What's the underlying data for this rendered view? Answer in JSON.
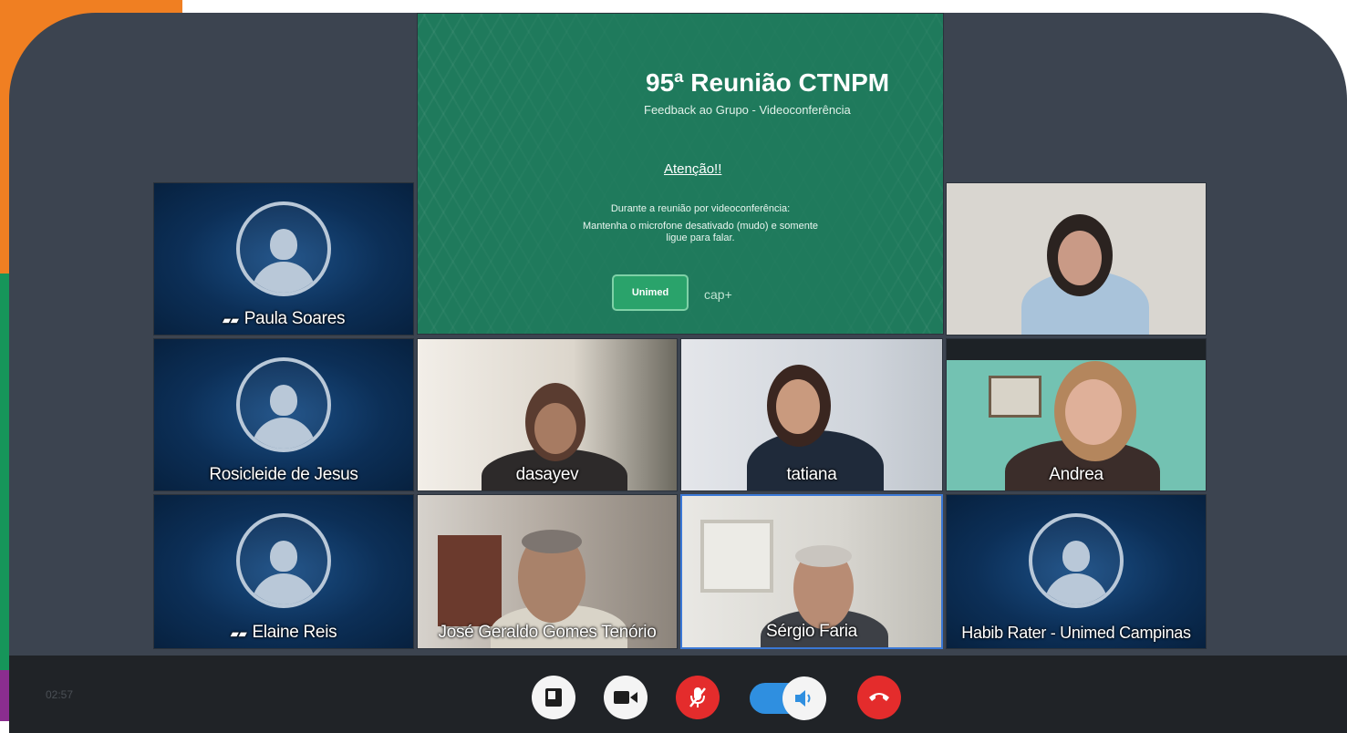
{
  "slide": {
    "title": "95ª Reunião CTNPM",
    "subtitle": "Feedback ao Grupo - Videoconferência",
    "attention": "Atenção!!",
    "line1": "Durante a reunião por videoconferência:",
    "line2": "Mantenha o microfone desativado (mudo) e somente",
    "line3": "ligue para falar.",
    "logo_label": "Unimed",
    "logo2_label": "cap+"
  },
  "participants": {
    "paula": "Paula Soares",
    "rosicleide": "Rosicleide de Jesus",
    "elaine": "Elaine Reis",
    "dasayev": "dasayev",
    "tatiana": "tatiana",
    "andrea": "Andrea",
    "jose": "José Geraldo Gomes Tenório",
    "sergio": "Sérgio Faria",
    "habib": "Habib Rater - Unimed Campinas"
  },
  "toolbar": {
    "timer": "02:57"
  },
  "colors": {
    "accent": "#2f8fe0",
    "end_call": "#e42c2c",
    "slide_bg": "#1f7a5c",
    "orange_brand": "#f07f22",
    "green_brand": "#16955a",
    "purple_brand": "#8b2d8f"
  },
  "icons": {
    "share": "share-screen-icon",
    "video": "video-camera-icon",
    "mic": "microphone-muted-icon",
    "speaker": "speaker-icon",
    "hangup": "hang-up-icon"
  }
}
